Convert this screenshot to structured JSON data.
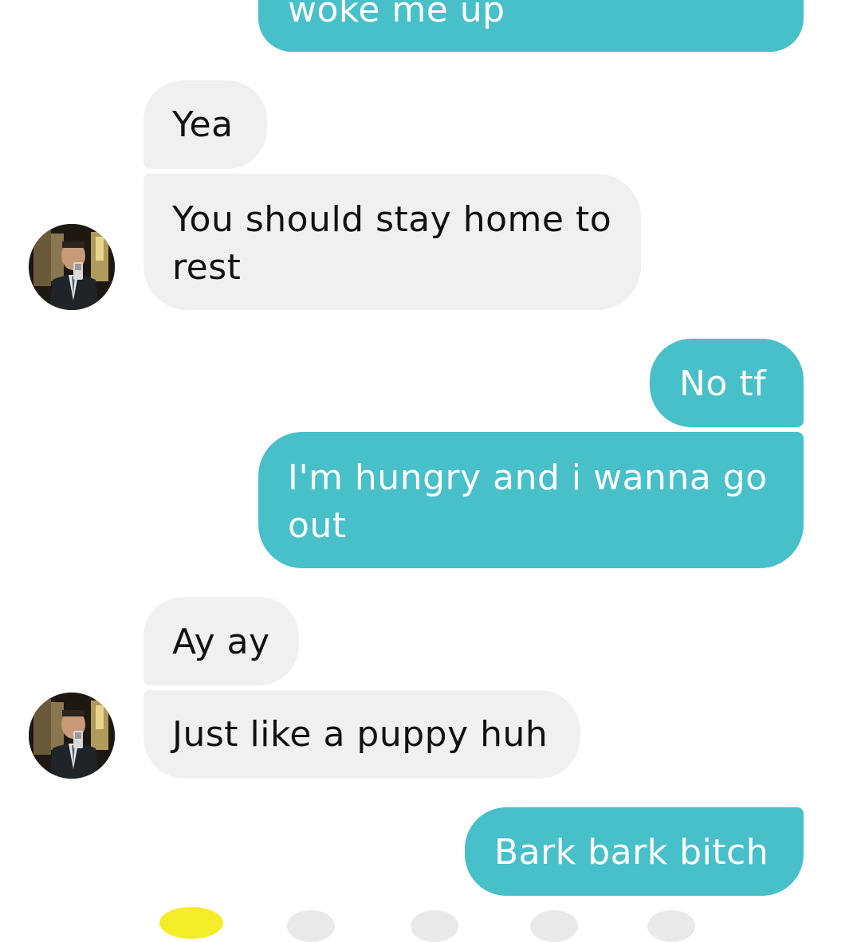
{
  "messages": [
    {
      "id": "m0",
      "side": "outgoing",
      "text": "woke me up"
    },
    {
      "id": "m1",
      "side": "incoming",
      "text": "Yea"
    },
    {
      "id": "m2",
      "side": "incoming",
      "text": "You should stay home to rest"
    },
    {
      "id": "m3",
      "side": "outgoing",
      "text": "No tf"
    },
    {
      "id": "m4",
      "side": "outgoing",
      "text": "I'm hungry and i wanna go out"
    },
    {
      "id": "m5",
      "side": "incoming",
      "text": "Ay ay"
    },
    {
      "id": "m6",
      "side": "incoming",
      "text": "Just like a puppy huh"
    },
    {
      "id": "m7",
      "side": "outgoing",
      "text": "Bark bark bitch"
    }
  ],
  "colors": {
    "outgoing_bubble": "#47c0c9",
    "incoming_bubble": "#f0f0f0",
    "outgoing_text": "#ffffff",
    "incoming_text": "#111111",
    "background": "#ffffff"
  },
  "icons": {
    "contact_avatar": "contact-avatar-photo",
    "bottom_bar": [
      "yellow-circle-icon",
      "gray-circle-icon",
      "gray-circle-icon",
      "gray-circle-icon",
      "gray-circle-icon"
    ]
  }
}
